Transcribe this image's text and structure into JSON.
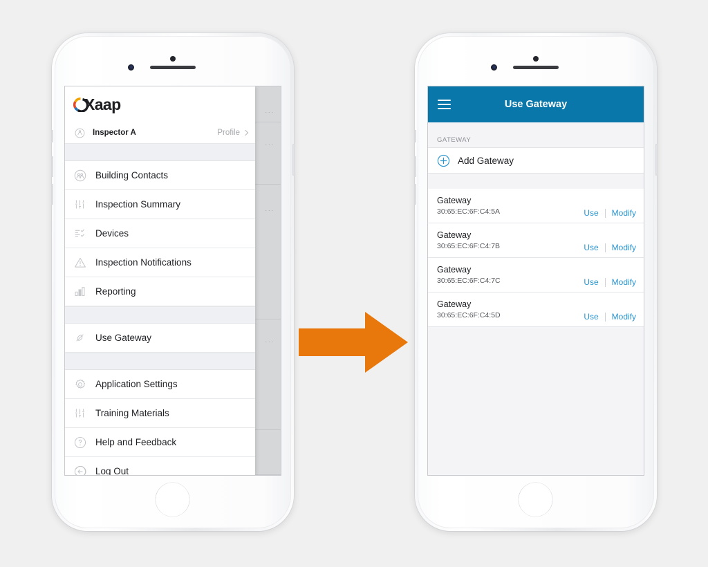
{
  "canvas": {
    "background": "#f0f0f0"
  },
  "colors": {
    "brand_blue": "#0a77ab",
    "tab_blue": "#12719e",
    "link_blue": "#2a94cf",
    "arrow_orange": "#E8780C",
    "screen_bg": "#f4f4f6"
  },
  "left_phone": {
    "screen_name": "navigation-drawer",
    "logo": {
      "text": "Xaap",
      "mark": "c-ring-icon"
    },
    "side_tab": {
      "icon": "more-vertical-icon"
    },
    "profile": {
      "icon": "person-icon",
      "name": "Inspector A",
      "link_label": "Profile",
      "chevron": "chevron-right-icon"
    },
    "menu_groups": [
      {
        "items": [
          {
            "label": "Building Contacts",
            "icon": "contacts-icon"
          },
          {
            "label": "Inspection Summary",
            "icon": "sliders-icon"
          },
          {
            "label": "Devices",
            "icon": "checklist-icon"
          },
          {
            "label": "Inspection Notifications",
            "icon": "warning-triangle-icon"
          },
          {
            "label": "Reporting",
            "icon": "bar-chart-icon"
          }
        ]
      },
      {
        "items": [
          {
            "label": "Use Gateway",
            "icon": "gateway-icon"
          }
        ]
      },
      {
        "items": [
          {
            "label": "Application Settings",
            "icon": "gear-icon"
          },
          {
            "label": "Training Materials",
            "icon": "sliders-icon"
          },
          {
            "label": "Help and Feedback",
            "icon": "question-circle-icon"
          },
          {
            "label": "Log Out",
            "icon": "logout-arrow-icon"
          }
        ]
      }
    ],
    "dimmed_background_rows": [
      "...",
      "...",
      "...",
      "..."
    ]
  },
  "right_phone": {
    "screen_name": "use-gateway-screen",
    "nav": {
      "menu_icon": "hamburger-icon",
      "title": "Use Gateway"
    },
    "section_header": "GATEWAY",
    "add_row": {
      "icon": "plus-circle-icon",
      "label": "Add Gateway"
    },
    "row_actions": {
      "use": "Use",
      "modify": "Modify"
    },
    "gateways": [
      {
        "title": "Gateway",
        "mac": "30:65:EC:6F:C4:5A"
      },
      {
        "title": "Gateway",
        "mac": "30:65:EC:6F:C4:7B"
      },
      {
        "title": "Gateway",
        "mac": "30:65:EC:6F:C4:7C"
      },
      {
        "title": "Gateway",
        "mac": "30:65:EC:6F:C4:5D"
      }
    ]
  },
  "arrow": {
    "icon": "arrow-right-icon",
    "direction": "right"
  }
}
